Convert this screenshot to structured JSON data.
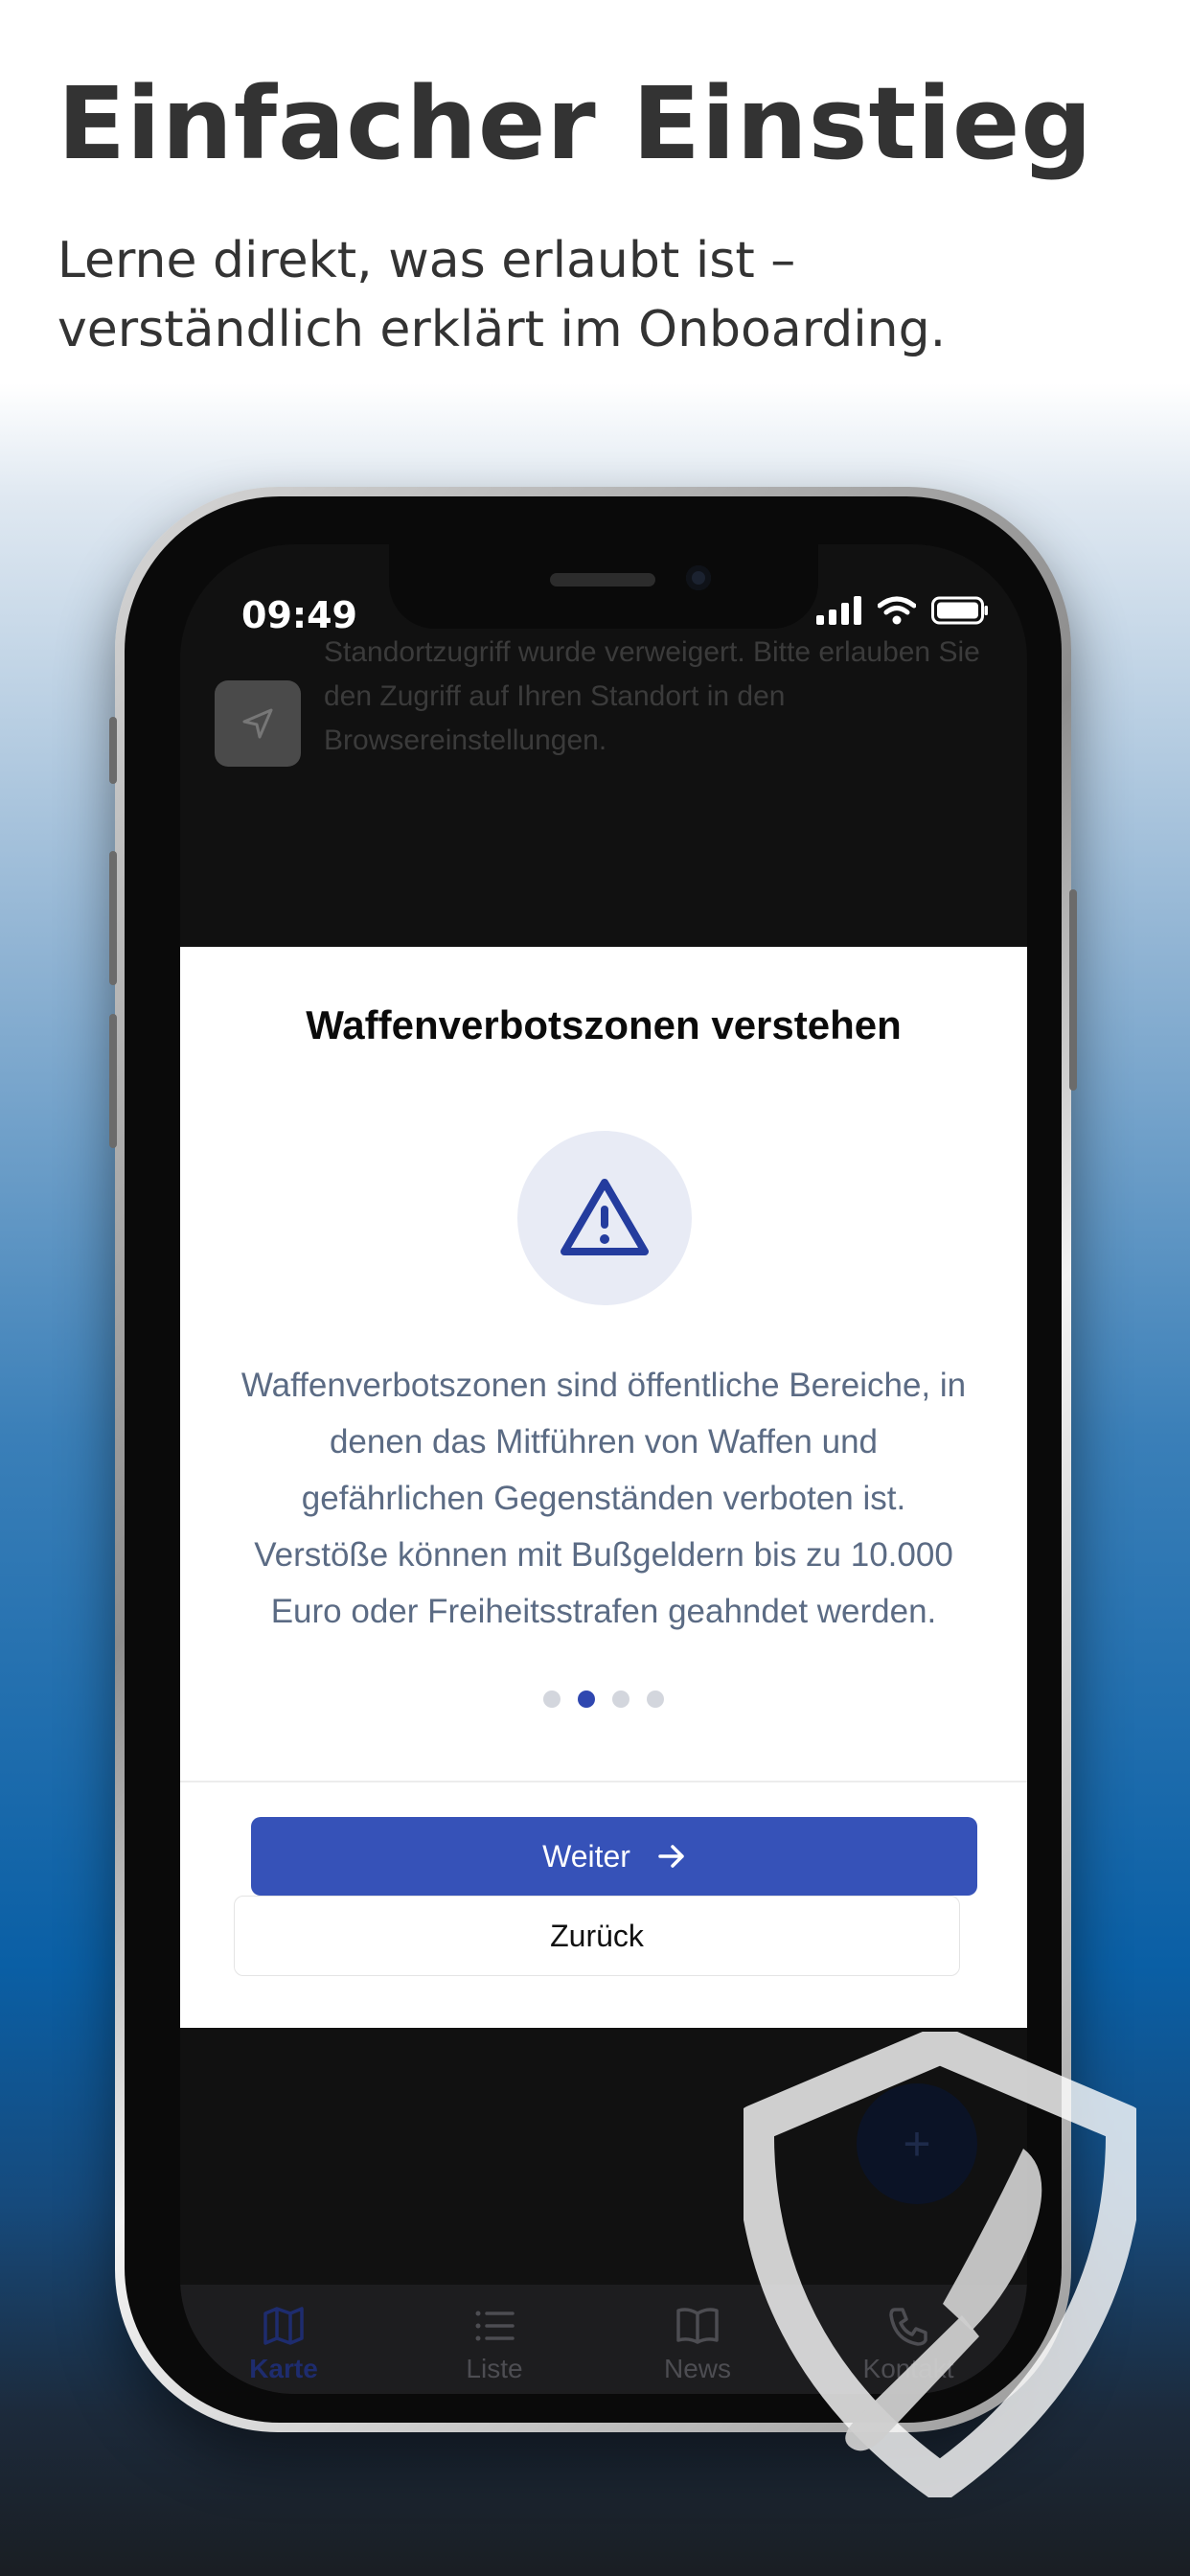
{
  "promo": {
    "headline": "Einfacher Einstieg",
    "subline": "Lerne direkt, was erlaubt ist – verständlich erklärt im Onboarding."
  },
  "status_bar": {
    "time": "09:49",
    "icons": [
      "signal-icon",
      "wifi-icon",
      "battery-icon"
    ]
  },
  "location_toast": {
    "icon": "navigation-arrow-icon",
    "message": "Standortzugriff wurde verweigert. Bitte erlauben Sie den Zugriff auf Ihren Standort in den Browsereinstellungen."
  },
  "onboarding": {
    "title": "Waffenverbotszonen verstehen",
    "icon": "warning-triangle-icon",
    "body": "Waffenverbotszonen sind öffentliche Bereiche, in denen das Mitführen von Waffen und gefährlichen Gegenständen verboten ist. Verstöße können mit Bußgeldern bis zu 10.000 Euro oder Freiheitsstrafen geahndet werden.",
    "pagination": {
      "total": 4,
      "current": 2
    },
    "next_label": "Weiter",
    "back_label": "Zurück"
  },
  "fab": {
    "icon": "plus-icon"
  },
  "tabbar": {
    "items": [
      {
        "label": "Karte",
        "icon": "map-icon",
        "active": true
      },
      {
        "label": "Liste",
        "icon": "list-icon",
        "active": false
      },
      {
        "label": "News",
        "icon": "book-icon",
        "active": false
      },
      {
        "label": "Kontakt",
        "icon": "phone-icon",
        "active": false
      }
    ]
  },
  "colors": {
    "primary": "#3652b8",
    "dot_active": "#2f47b0",
    "body_text": "#5b6b84",
    "headline_text": "#333333"
  }
}
